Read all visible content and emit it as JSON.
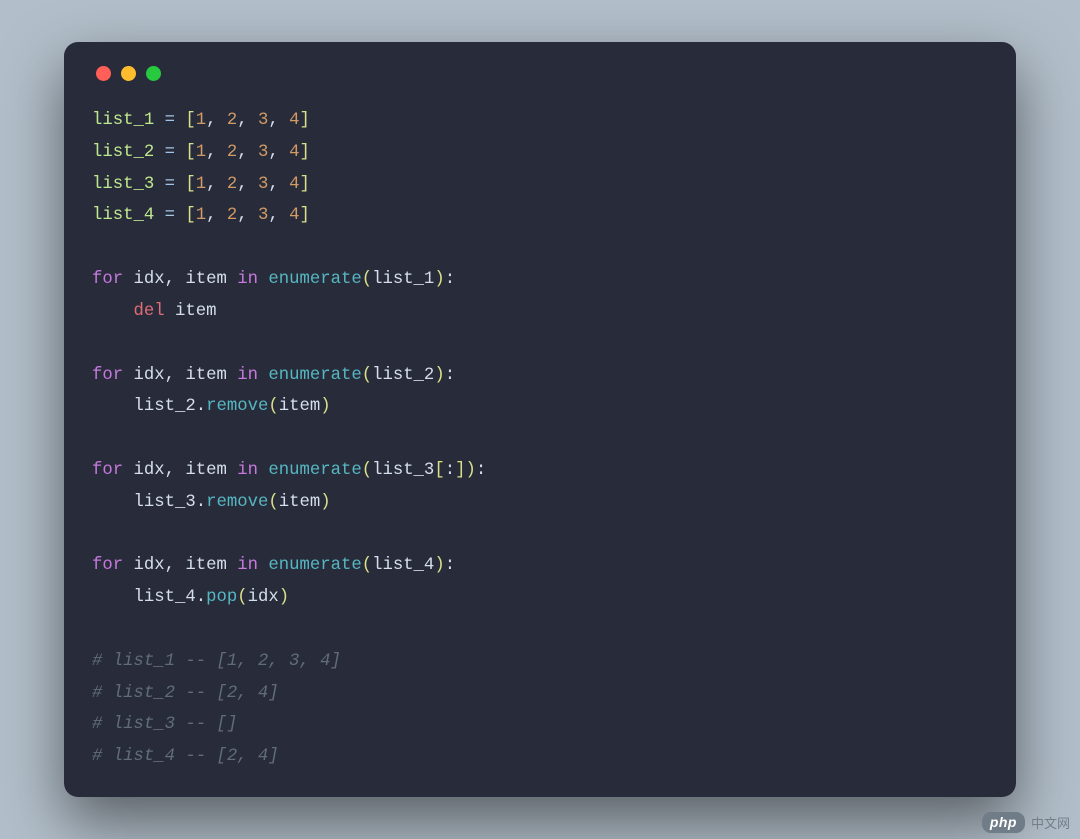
{
  "traffic": {
    "r": "close",
    "y": "minimize",
    "g": "zoom"
  },
  "code": {
    "l01": {
      "v": "list_1",
      "eq": "=",
      "lb": "[",
      "n1": "1",
      "c": ",",
      "n2": "2",
      "n3": "3",
      "n4": "4",
      "rb": "]"
    },
    "l02": {
      "v": "list_2",
      "eq": "=",
      "lb": "[",
      "n1": "1",
      "c": ",",
      "n2": "2",
      "n3": "3",
      "n4": "4",
      "rb": "]"
    },
    "l03": {
      "v": "list_3",
      "eq": "=",
      "lb": "[",
      "n1": "1",
      "c": ",",
      "n2": "2",
      "n3": "3",
      "n4": "4",
      "rb": "]"
    },
    "l04": {
      "v": "list_4",
      "eq": "=",
      "lb": "[",
      "n1": "1",
      "c": ",",
      "n2": "2",
      "n3": "3",
      "n4": "4",
      "rb": "]"
    },
    "l06": {
      "for": "for",
      "idx": "idx",
      "c": ",",
      "item": "item",
      "in": "in",
      "call": "enumerate",
      "lp": "(",
      "arg": "list_1",
      "rp": ")",
      "colon": ":"
    },
    "l07": {
      "del": "del",
      "item": "item"
    },
    "l09": {
      "for": "for",
      "idx": "idx",
      "c": ",",
      "item": "item",
      "in": "in",
      "call": "enumerate",
      "lp": "(",
      "arg": "list_2",
      "rp": ")",
      "colon": ":"
    },
    "l10": {
      "obj": "list_2",
      "dot": ".",
      "meth": "remove",
      "lp": "(",
      "arg": "item",
      "rp": ")"
    },
    "l12": {
      "for": "for",
      "idx": "idx",
      "c": ",",
      "item": "item",
      "in": "in",
      "call": "enumerate",
      "lp": "(",
      "arg": "list_3",
      "lb": "[",
      "colon2": ":",
      "rb": "]",
      "rp": ")",
      "colon": ":"
    },
    "l13": {
      "obj": "list_3",
      "dot": ".",
      "meth": "remove",
      "lp": "(",
      "arg": "item",
      "rp": ")"
    },
    "l15": {
      "for": "for",
      "idx": "idx",
      "c": ",",
      "item": "item",
      "in": "in",
      "call": "enumerate",
      "lp": "(",
      "arg": "list_4",
      "rp": ")",
      "colon": ":"
    },
    "l16": {
      "obj": "list_4",
      "dot": ".",
      "meth": "pop",
      "lp": "(",
      "arg": "idx",
      "rp": ")"
    },
    "c1": "# list_1 -- [1, 2, 3, 4]",
    "c2": "# list_2 -- [2, 4]",
    "c3": "# list_3 -- []",
    "c4": "# list_4 -- [2, 4]"
  },
  "watermark": {
    "badge": "php",
    "text": "中文网"
  }
}
